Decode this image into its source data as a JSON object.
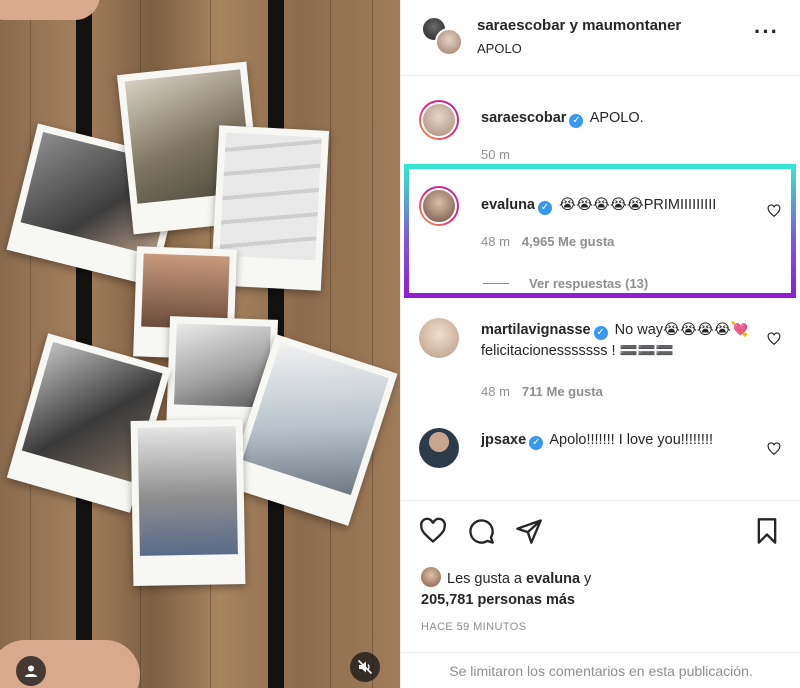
{
  "post": {
    "header": {
      "users": "saraescobar y maumontaner",
      "subtitle": "APOLO"
    }
  },
  "comments": [
    {
      "username": "saraescobar",
      "verified": true,
      "text": "APOLO.",
      "time": "50 m"
    },
    {
      "username": "evaluna",
      "verified": true,
      "text": "😭😭😭😭😭PRIMIIIIIIIII",
      "time": "48 m",
      "likes": "4,965 Me gusta",
      "replies": "Ver respuestas (13)"
    },
    {
      "username": "martilavignasse",
      "verified": true,
      "text": "No way😭😭😭😭💘 felicitacionesssssss ! 🟰🟰🟰",
      "time": "48 m",
      "likes": "711 Me gusta"
    },
    {
      "username": "jpsaxe",
      "verified": true,
      "text": "Apolo!!!!!!! I love you!!!!!!!!"
    }
  ],
  "likes_summary": {
    "prefix": "Les gusta a",
    "user": "evaluna",
    "joiner": "y",
    "count": "205,781 personas más"
  },
  "posted_ago": "HACE 59 MINUTOS",
  "comments_limited": "Se limitaron los comentarios en esta publicación.",
  "colors": {
    "verified": "#3897f0",
    "highlight_top": "#33e6cf",
    "highlight_bottom": "#8f1fd6"
  }
}
